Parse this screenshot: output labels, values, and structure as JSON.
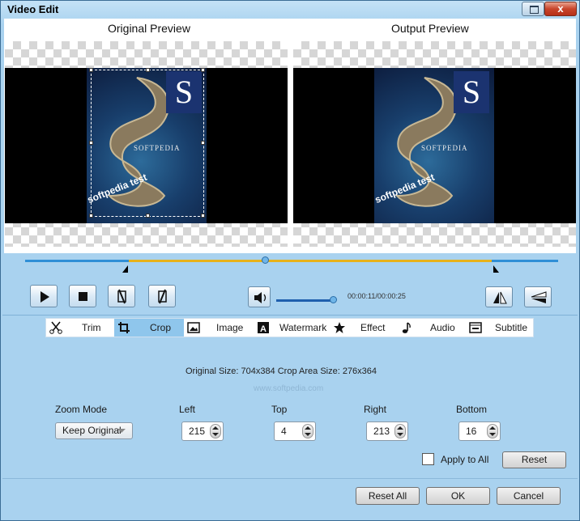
{
  "window": {
    "title": "Video Edit",
    "close_glyph": "x"
  },
  "preview": {
    "original_label": "Original Preview",
    "output_label": "Output Preview",
    "poster_brand": "SOFTPEDIA",
    "poster_tag": "softpedia test",
    "poster_logo": "S"
  },
  "player": {
    "timecode": "00:00:11/00:00:25",
    "volume_level": 0.92,
    "position_fraction": 0.45
  },
  "tabs": [
    {
      "label": "Trim",
      "icon": "scissors-icon"
    },
    {
      "label": "Crop",
      "icon": "crop-icon"
    },
    {
      "label": "Image",
      "icon": "image-icon"
    },
    {
      "label": "Watermark",
      "icon": "watermark-icon"
    },
    {
      "label": "Effect",
      "icon": "star-icon"
    },
    {
      "label": "Audio",
      "icon": "music-note-icon"
    },
    {
      "label": "Subtitle",
      "icon": "subtitle-icon"
    }
  ],
  "active_tab": "Crop",
  "crop": {
    "info": "Original Size: 704x384  Crop Area Size: 276x364",
    "watermark": "www.softpedia.com",
    "zoom_mode_label": "Zoom Mode",
    "zoom_mode_value": "Keep Original",
    "left_label": "Left",
    "left_value": "215",
    "top_label": "Top",
    "top_value": "4",
    "right_label": "Right",
    "right_value": "213",
    "bottom_label": "Bottom",
    "bottom_value": "16",
    "apply_all_label": "Apply to All",
    "reset_label": "Reset"
  },
  "footer": {
    "reset_all": "Reset All",
    "ok": "OK",
    "cancel": "Cancel"
  },
  "colors": {
    "accent": "#2f8fd6",
    "selection": "#e8b21a",
    "tab_active": "#8fc6ec",
    "window_bg": "#a9d2ef"
  }
}
